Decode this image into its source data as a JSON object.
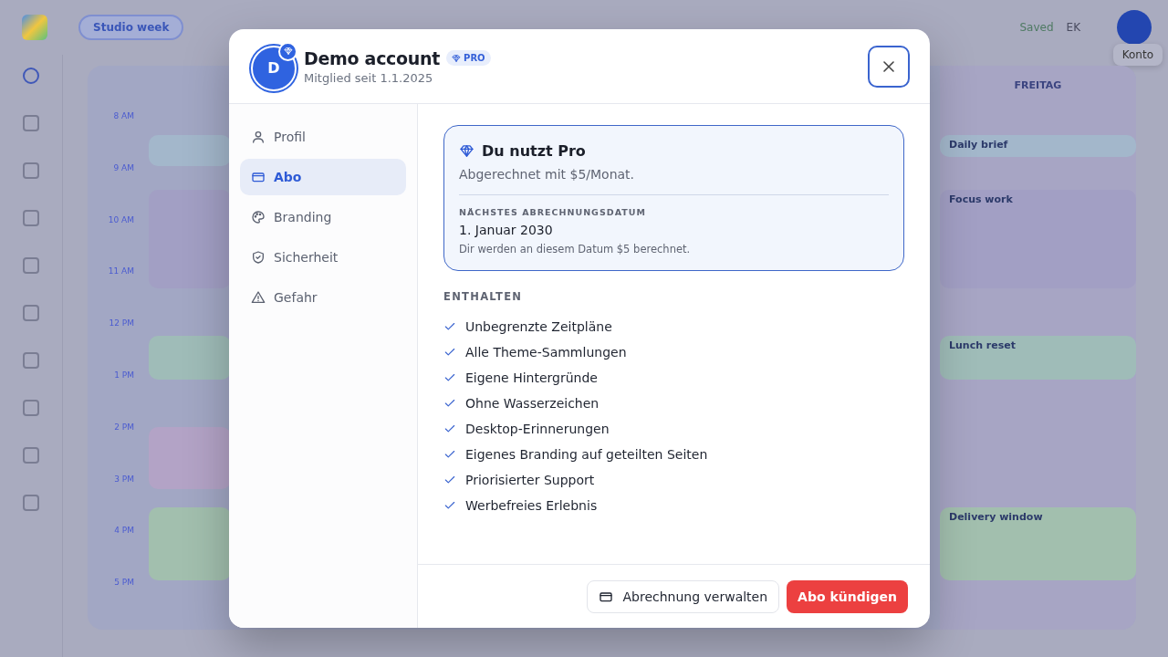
{
  "app": {
    "schedule_tab": "Studio week",
    "save_status": "Saved",
    "user_initials": "EK",
    "account_label": "Konto",
    "day_header": "FREITAG",
    "times": [
      "8 AM",
      "9 AM",
      "10 AM",
      "11 AM",
      "12 PM",
      "1 PM",
      "2 PM",
      "3 PM",
      "4 PM",
      "5 PM"
    ],
    "left_events": [
      {
        "color": "#a3b7cb"
      },
      {
        "color": "#a29fc4"
      },
      {
        "color": "#9fbcb8"
      },
      {
        "color": "#b3a3c6"
      },
      {
        "color": "#a2bfae"
      }
    ],
    "friday_events": [
      {
        "title": "Daily brief",
        "color": "#a3b7cb"
      },
      {
        "title": "Focus work",
        "color": "#a29fc4"
      },
      {
        "title": "Lunch reset",
        "color": "#9fbcb8"
      },
      {
        "title": "Delivery window",
        "color": "#a2bfae"
      }
    ]
  },
  "modal": {
    "avatar_initial": "D",
    "name": "Demo account",
    "badge": "PRO",
    "member_since": "Mitglied seit 1.1.2025",
    "nav": [
      {
        "label": "Profil",
        "selected": false
      },
      {
        "label": "Abo",
        "selected": true
      },
      {
        "label": "Branding",
        "selected": false
      },
      {
        "label": "Sicherheit",
        "selected": false
      },
      {
        "label": "Gefahr",
        "selected": false
      }
    ],
    "plan": {
      "title": "Du nutzt Pro",
      "billing": "Abgerechnet mit $5/Monat.",
      "next_label": "NÄCHSTES ABRECHNUNGSDATUM",
      "next_date": "1. Januar 2030",
      "note": "Dir werden an diesem Datum $5 berechnet."
    },
    "included_label": "ENTHALTEN",
    "features": [
      "Unbegrenzte Zeitpläne",
      "Alle Theme-Sammlungen",
      "Eigene Hintergründe",
      "Ohne Wasserzeichen",
      "Desktop-Erinnerungen",
      "Eigenes Branding auf geteilten Seiten",
      "Priorisierter Support",
      "Werbefreies Erlebnis"
    ],
    "buttons": [
      {
        "label": "Abrechnung verwalten",
        "kind": "secondary"
      },
      {
        "label": "Abo kündigen",
        "kind": "danger"
      }
    ]
  }
}
